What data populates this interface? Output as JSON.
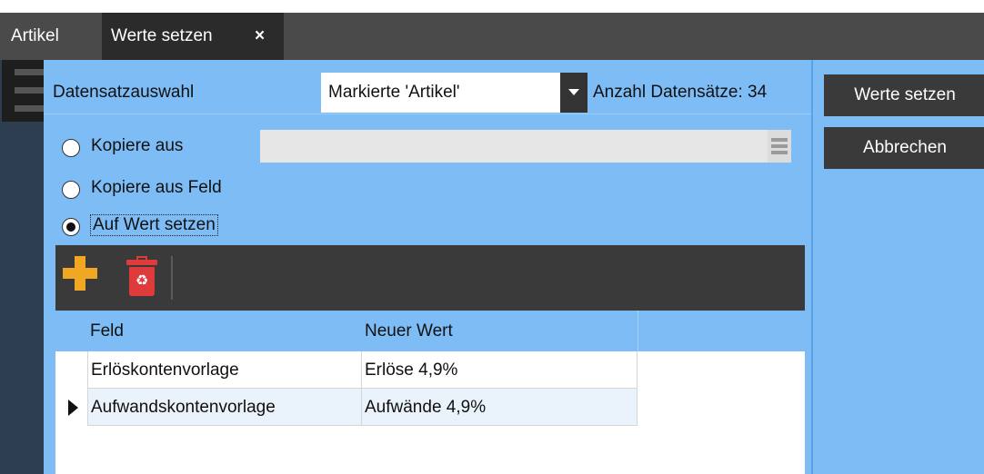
{
  "tabs": [
    {
      "label": "Artikel"
    },
    {
      "label": "Werte setzen",
      "close": "×"
    }
  ],
  "header": {
    "datensatz_label": "Datensatzauswahl",
    "selection_value": "Markierte 'Artikel'",
    "count_label": "Anzahl Datensätze: 34"
  },
  "options": {
    "kopiere_aus": "Kopiere aus",
    "kopiere_aus_feld": "Kopiere aus Feld",
    "auf_wert_setzen": "Auf Wert setzen",
    "selected": "auf_wert_setzen"
  },
  "toolbar": {
    "add_icon": "plus-icon",
    "delete_icon": "trash-icon",
    "delete_glyph": "♻"
  },
  "grid": {
    "columns": [
      "Feld",
      "Neuer Wert"
    ],
    "rows": [
      {
        "feld": "Erlöskontenvorlage",
        "wert": "Erlöse 4,9%"
      },
      {
        "feld": "Aufwandskontenvorlage",
        "wert": "Aufwände 4,9%"
      }
    ],
    "current_row": 1
  },
  "actions": {
    "apply": "Werte setzen",
    "cancel": "Abbrechen"
  },
  "colors": {
    "panel_blue": "#7dbcf5",
    "dark": "#3a3a3a",
    "accent_orange": "#f0a824",
    "accent_red": "#e03b3b"
  }
}
